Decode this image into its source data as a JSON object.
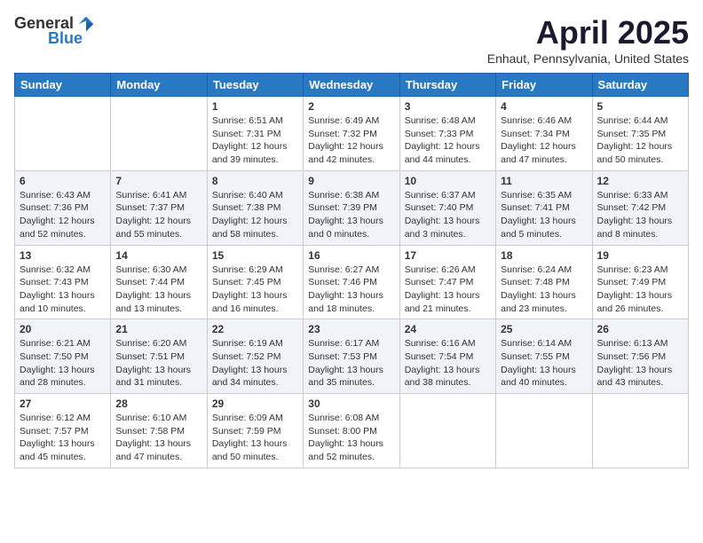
{
  "logo": {
    "general": "General",
    "blue": "Blue"
  },
  "title": "April 2025",
  "location": "Enhaut, Pennsylvania, United States",
  "days_of_week": [
    "Sunday",
    "Monday",
    "Tuesday",
    "Wednesday",
    "Thursday",
    "Friday",
    "Saturday"
  ],
  "weeks": [
    [
      {
        "day": "",
        "info": ""
      },
      {
        "day": "",
        "info": ""
      },
      {
        "day": "1",
        "info": "Sunrise: 6:51 AM\nSunset: 7:31 PM\nDaylight: 12 hours and 39 minutes."
      },
      {
        "day": "2",
        "info": "Sunrise: 6:49 AM\nSunset: 7:32 PM\nDaylight: 12 hours and 42 minutes."
      },
      {
        "day": "3",
        "info": "Sunrise: 6:48 AM\nSunset: 7:33 PM\nDaylight: 12 hours and 44 minutes."
      },
      {
        "day": "4",
        "info": "Sunrise: 6:46 AM\nSunset: 7:34 PM\nDaylight: 12 hours and 47 minutes."
      },
      {
        "day": "5",
        "info": "Sunrise: 6:44 AM\nSunset: 7:35 PM\nDaylight: 12 hours and 50 minutes."
      }
    ],
    [
      {
        "day": "6",
        "info": "Sunrise: 6:43 AM\nSunset: 7:36 PM\nDaylight: 12 hours and 52 minutes."
      },
      {
        "day": "7",
        "info": "Sunrise: 6:41 AM\nSunset: 7:37 PM\nDaylight: 12 hours and 55 minutes."
      },
      {
        "day": "8",
        "info": "Sunrise: 6:40 AM\nSunset: 7:38 PM\nDaylight: 12 hours and 58 minutes."
      },
      {
        "day": "9",
        "info": "Sunrise: 6:38 AM\nSunset: 7:39 PM\nDaylight: 13 hours and 0 minutes."
      },
      {
        "day": "10",
        "info": "Sunrise: 6:37 AM\nSunset: 7:40 PM\nDaylight: 13 hours and 3 minutes."
      },
      {
        "day": "11",
        "info": "Sunrise: 6:35 AM\nSunset: 7:41 PM\nDaylight: 13 hours and 5 minutes."
      },
      {
        "day": "12",
        "info": "Sunrise: 6:33 AM\nSunset: 7:42 PM\nDaylight: 13 hours and 8 minutes."
      }
    ],
    [
      {
        "day": "13",
        "info": "Sunrise: 6:32 AM\nSunset: 7:43 PM\nDaylight: 13 hours and 10 minutes."
      },
      {
        "day": "14",
        "info": "Sunrise: 6:30 AM\nSunset: 7:44 PM\nDaylight: 13 hours and 13 minutes."
      },
      {
        "day": "15",
        "info": "Sunrise: 6:29 AM\nSunset: 7:45 PM\nDaylight: 13 hours and 16 minutes."
      },
      {
        "day": "16",
        "info": "Sunrise: 6:27 AM\nSunset: 7:46 PM\nDaylight: 13 hours and 18 minutes."
      },
      {
        "day": "17",
        "info": "Sunrise: 6:26 AM\nSunset: 7:47 PM\nDaylight: 13 hours and 21 minutes."
      },
      {
        "day": "18",
        "info": "Sunrise: 6:24 AM\nSunset: 7:48 PM\nDaylight: 13 hours and 23 minutes."
      },
      {
        "day": "19",
        "info": "Sunrise: 6:23 AM\nSunset: 7:49 PM\nDaylight: 13 hours and 26 minutes."
      }
    ],
    [
      {
        "day": "20",
        "info": "Sunrise: 6:21 AM\nSunset: 7:50 PM\nDaylight: 13 hours and 28 minutes."
      },
      {
        "day": "21",
        "info": "Sunrise: 6:20 AM\nSunset: 7:51 PM\nDaylight: 13 hours and 31 minutes."
      },
      {
        "day": "22",
        "info": "Sunrise: 6:19 AM\nSunset: 7:52 PM\nDaylight: 13 hours and 34 minutes."
      },
      {
        "day": "23",
        "info": "Sunrise: 6:17 AM\nSunset: 7:53 PM\nDaylight: 13 hours and 35 minutes."
      },
      {
        "day": "24",
        "info": "Sunrise: 6:16 AM\nSunset: 7:54 PM\nDaylight: 13 hours and 38 minutes."
      },
      {
        "day": "25",
        "info": "Sunrise: 6:14 AM\nSunset: 7:55 PM\nDaylight: 13 hours and 40 minutes."
      },
      {
        "day": "26",
        "info": "Sunrise: 6:13 AM\nSunset: 7:56 PM\nDaylight: 13 hours and 43 minutes."
      }
    ],
    [
      {
        "day": "27",
        "info": "Sunrise: 6:12 AM\nSunset: 7:57 PM\nDaylight: 13 hours and 45 minutes."
      },
      {
        "day": "28",
        "info": "Sunrise: 6:10 AM\nSunset: 7:58 PM\nDaylight: 13 hours and 47 minutes."
      },
      {
        "day": "29",
        "info": "Sunrise: 6:09 AM\nSunset: 7:59 PM\nDaylight: 13 hours and 50 minutes."
      },
      {
        "day": "30",
        "info": "Sunrise: 6:08 AM\nSunset: 8:00 PM\nDaylight: 13 hours and 52 minutes."
      },
      {
        "day": "",
        "info": ""
      },
      {
        "day": "",
        "info": ""
      },
      {
        "day": "",
        "info": ""
      }
    ]
  ]
}
